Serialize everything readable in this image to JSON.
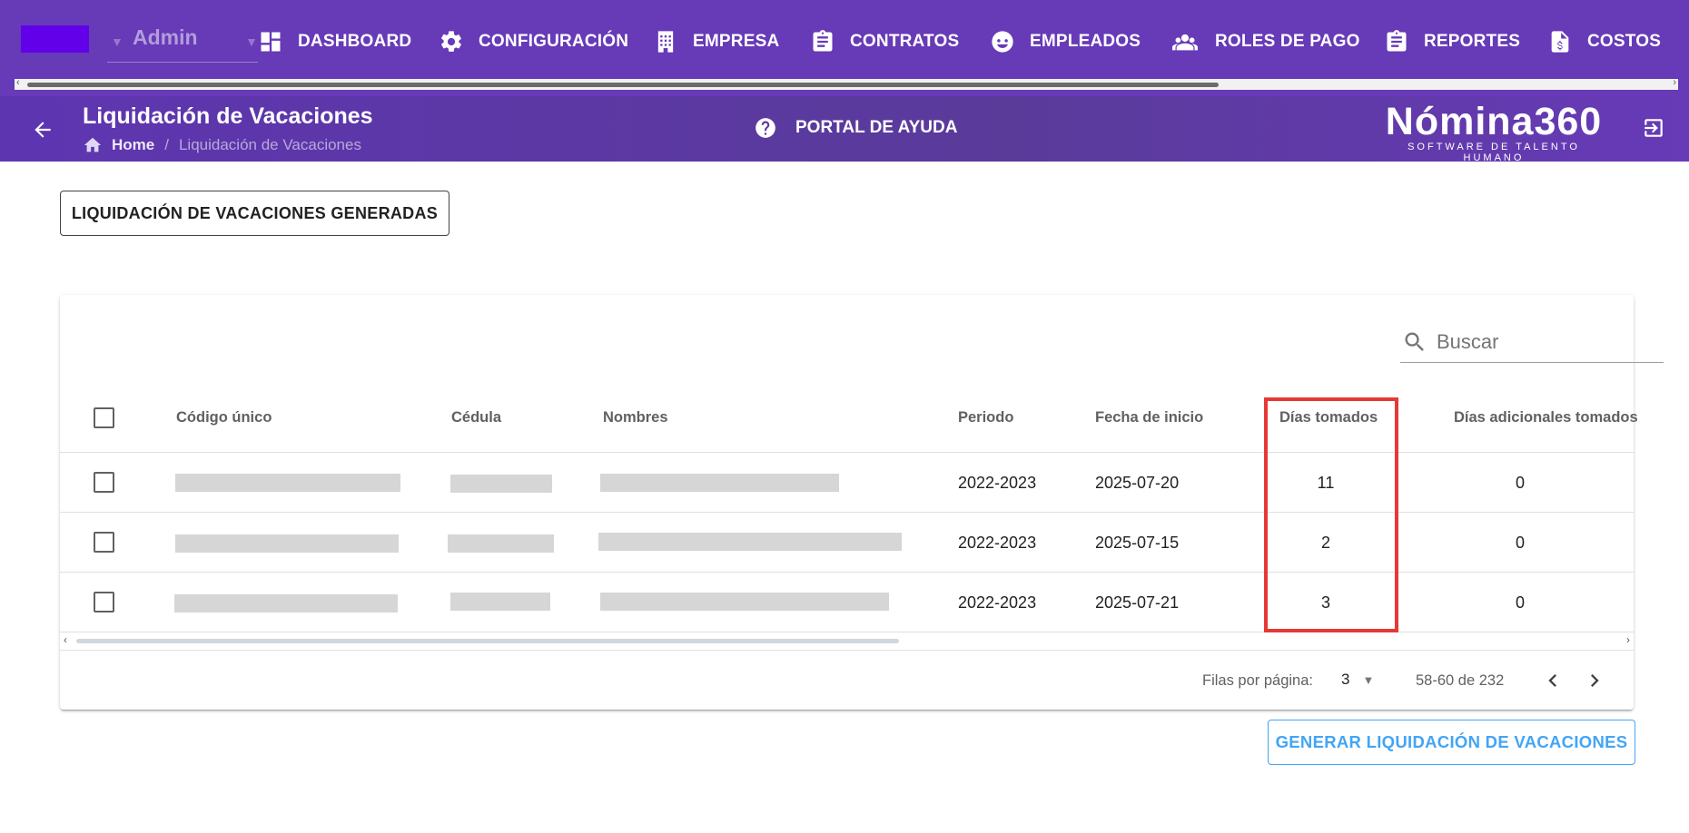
{
  "topbar": {
    "role_value": "Admin",
    "nav": [
      {
        "label": "DASHBOARD",
        "icon": "dashboard-icon"
      },
      {
        "label": "CONFIGURACIÓN",
        "icon": "gear-icon"
      },
      {
        "label": "EMPRESA",
        "icon": "building-icon"
      },
      {
        "label": "CONTRATOS",
        "icon": "clipboard-icon"
      },
      {
        "label": "EMPLEADOS",
        "icon": "face-icon"
      },
      {
        "label": "ROLES DE PAGO",
        "icon": "users-icon"
      },
      {
        "label": "REPORTES",
        "icon": "clipboard-icon"
      },
      {
        "label": "COSTOS",
        "icon": "invoice-dollar-icon"
      }
    ],
    "colors": {
      "bar": "#673ab7",
      "role_block": "#6200ea"
    }
  },
  "header": {
    "title": "Liquidación de Vacaciones",
    "breadcrumb": {
      "home": "Home",
      "separator": "/",
      "current": "Liquidación de Vacaciones"
    },
    "help_label": "PORTAL DE AYUDA",
    "logo_main": "Nómina360",
    "logo_tagline": "SOFTWARE DE TALENTO HUMANO"
  },
  "actions": {
    "generated_label": "LIQUIDACIÓN DE VACACIONES GENERADAS",
    "generate_label": "GENERAR LIQUIDACIÓN DE VACACIONES"
  },
  "table": {
    "search_placeholder": "Buscar",
    "columns": [
      "Código único",
      "Cédula",
      "Nombres",
      "Periodo",
      "Fecha de inicio",
      "Días tomados",
      "Días adicionales tomados"
    ],
    "rows": [
      {
        "periodo": "2022-2023",
        "fecha_inicio": "2025-07-20",
        "dias_tomados": "11",
        "dias_adicionales": "0"
      },
      {
        "periodo": "2022-2023",
        "fecha_inicio": "2025-07-15",
        "dias_tomados": "2",
        "dias_adicionales": "0"
      },
      {
        "periodo": "2022-2023",
        "fecha_inicio": "2025-07-21",
        "dias_tomados": "3",
        "dias_adicionales": "0"
      }
    ],
    "footer": {
      "rows_per_page_label": "Filas por página:",
      "rows_per_page_value": "3",
      "range_text": "58-60 de 232"
    }
  },
  "highlight_color": "#e53935"
}
